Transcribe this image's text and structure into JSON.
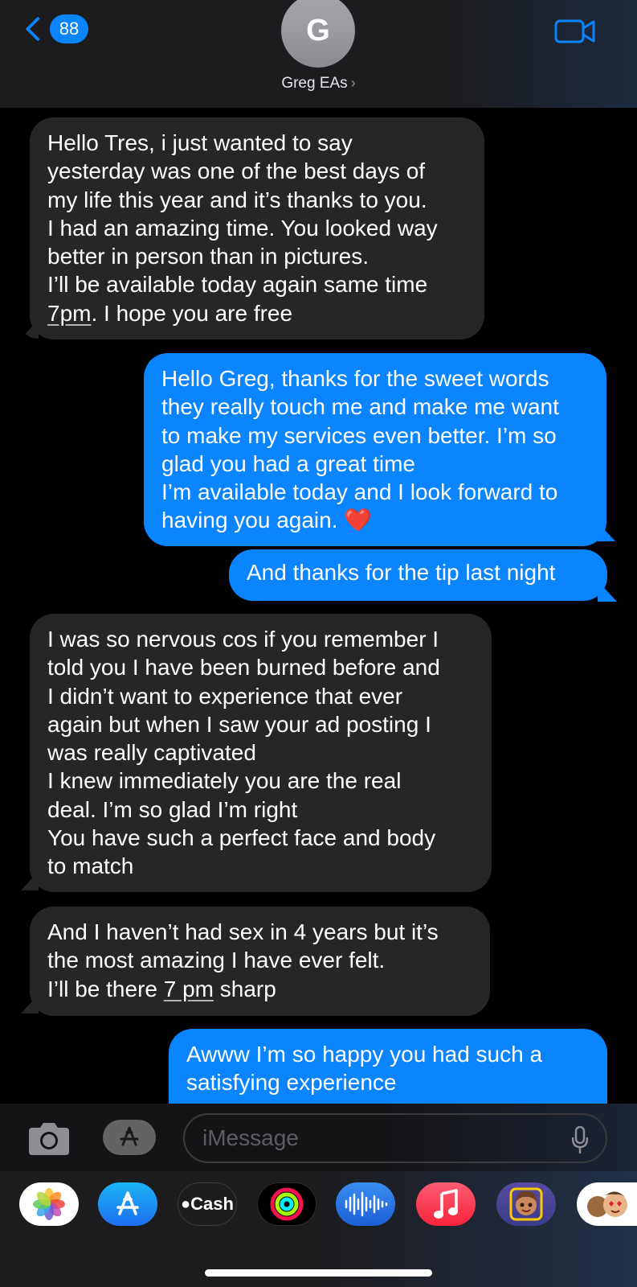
{
  "header": {
    "back_badge": "88",
    "avatar_initial": "G",
    "contact_name": "Greg EAs",
    "chevron": "›"
  },
  "messages": [
    {
      "side": "incoming",
      "text_parts": [
        "Hello Tres, i just wanted to say\nyesterday was one of the best days of\nmy life this year and it’s thanks to you.\nI had an amazing time. You looked way\nbetter in person than in pictures.\nI’ll be available today again same time\n",
        "7pm",
        ". I hope you are free"
      ]
    },
    {
      "side": "outgoing",
      "text": "Hello Greg, thanks for the sweet words\nthey really touch me and make me want\nto make my services even better. I’m so\nglad you had a great time\nI’m available today and I look forward to\nhaving you again. ❤️"
    },
    {
      "side": "outgoing",
      "text": "And thanks for the tip last night"
    },
    {
      "side": "incoming",
      "text": "I was so nervous cos if you remember I\ntold you I have been burned before and\nI didn’t want to experience that ever\nagain but when I saw your ad posting I\nwas really captivated\nI knew immediately you are the real\ndeal. I’m so glad I’m right\nYou have such a perfect face and body\nto match"
    },
    {
      "side": "incoming",
      "text_parts": [
        "And I haven’t had sex in 4 years but it’s\nthe most amazing I have ever felt.\nI’ll be there ",
        "7 pm",
        " sharp"
      ]
    },
    {
      "side": "outgoing",
      "text": "Awww I’m so happy you had such a\nsatisfying experience"
    }
  ],
  "input": {
    "placeholder": "iMessage"
  },
  "apps": [
    {
      "name": "photos-app-icon"
    },
    {
      "name": "app-store-app-icon"
    },
    {
      "name": "apple-cash-app-icon",
      "label": "Cash"
    },
    {
      "name": "fitness-app-icon"
    },
    {
      "name": "audio-message-app-icon"
    },
    {
      "name": "music-app-icon"
    },
    {
      "name": "memoji-app-icon"
    },
    {
      "name": "memoji-stickers-app-icon"
    }
  ],
  "colors": {
    "accent": "#0a84ff",
    "incoming_bubble": "#262628",
    "outgoing_bubble": "#0a84ff"
  }
}
